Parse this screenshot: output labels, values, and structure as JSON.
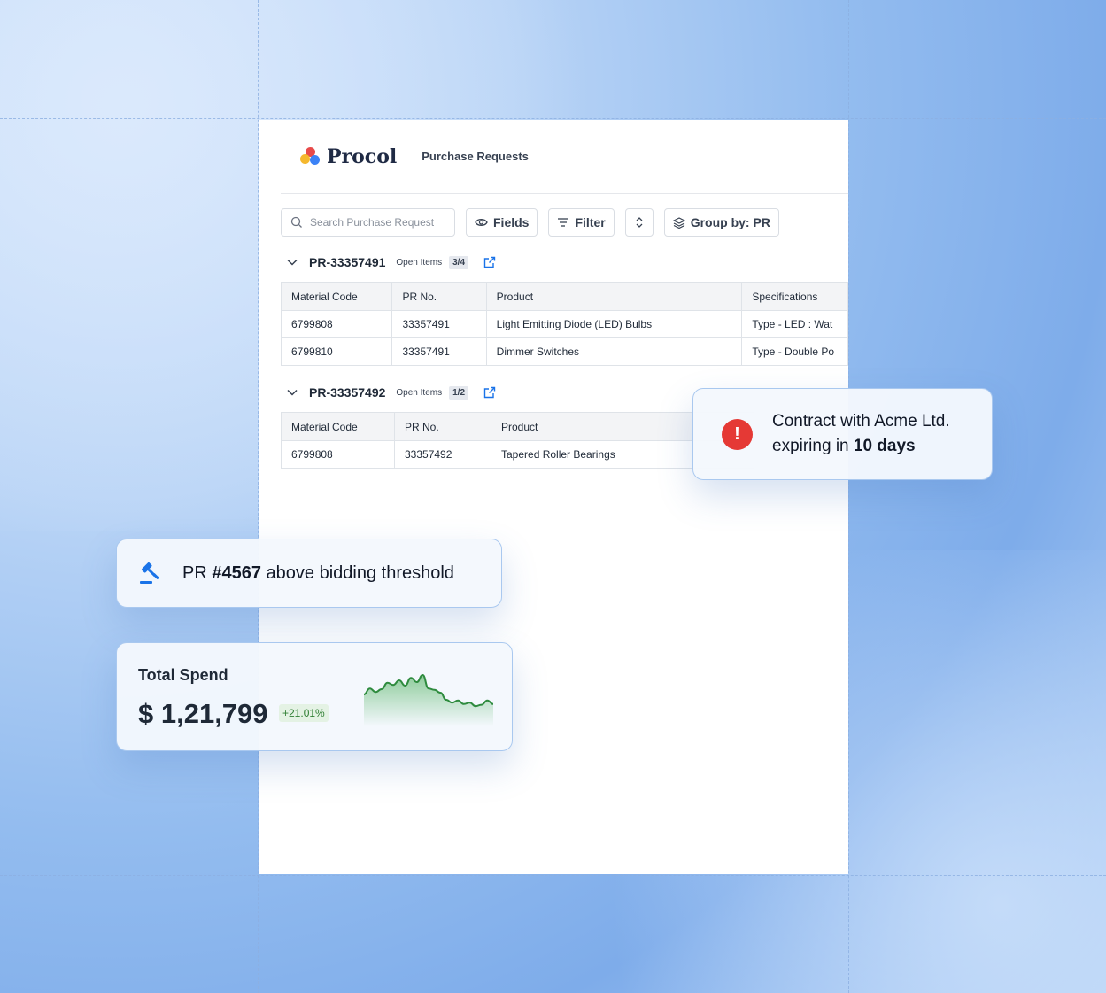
{
  "header": {
    "logo_text": "Procol",
    "title": "Purchase Requests"
  },
  "toolbar": {
    "search_placeholder": "Search Purchase Request",
    "fields_label": "Fields",
    "filter_label": "Filter",
    "group_by_label": "Group by: PR"
  },
  "groups": [
    {
      "id": "PR-33357491",
      "open_items_label": "Open Items",
      "count": "3/4",
      "columns": [
        "Material Code",
        "PR No.",
        "Product",
        "Specifications"
      ],
      "rows": [
        [
          "6799808",
          "33357491",
          "Light Emitting Diode (LED) Bulbs",
          "Type - LED :  Wat"
        ],
        [
          "6799810",
          "33357491",
          "Dimmer Switches",
          "Type - Double Po"
        ]
      ]
    },
    {
      "id": "PR-33357492",
      "open_items_label": "Open Items",
      "count": "1/2",
      "columns": [
        "Material Code",
        "PR No.",
        "Product"
      ],
      "rows": [
        [
          "6799808",
          "33357492",
          "Tapered Roller Bearings"
        ]
      ]
    }
  ],
  "contract_alert": {
    "line1": "Contract with Acme Ltd.",
    "line2_prefix": "expiring in ",
    "line2_bold": "10 days"
  },
  "bid_alert": {
    "prefix": "PR ",
    "bold": "#4567",
    "suffix": " above bidding threshold"
  },
  "spend": {
    "label": "Total Spend",
    "value": "$ 1,21,799",
    "change": "+21.01%",
    "sparkline": [
      0.45,
      0.62,
      0.52,
      0.6,
      0.78,
      0.72,
      0.85,
      0.7,
      0.92,
      0.8,
      1.0,
      0.62,
      0.58,
      0.5,
      0.3,
      0.22,
      0.28,
      0.18,
      0.22,
      0.12,
      0.16,
      0.28,
      0.18
    ],
    "line_color": "#2e8b3e",
    "fill_color": "#7cc48a"
  },
  "colors": {
    "alert": "#e53935",
    "accent": "#1a73e8"
  }
}
